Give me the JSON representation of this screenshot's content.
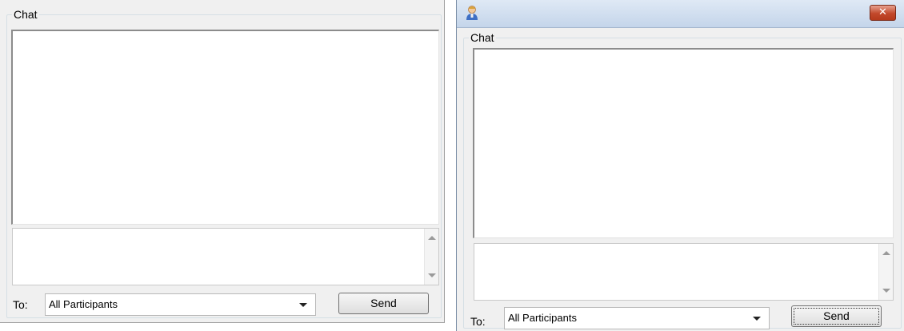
{
  "left_dialog": {
    "group_label": "Chat",
    "to_label": "To:",
    "recipient": "All Participants",
    "send_label": "Send"
  },
  "right_dialog": {
    "title_icon": "user-avatar-icon",
    "close_glyph": "✕",
    "group_label": "Chat",
    "to_label": "To:",
    "recipient": "All Participants",
    "send_label": "Send"
  }
}
